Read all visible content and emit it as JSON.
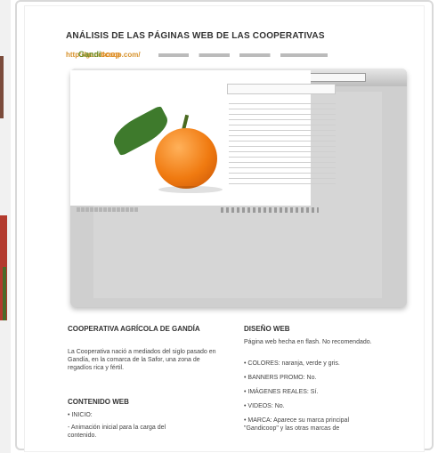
{
  "doc": {
    "title": "ANÁLISIS DE LAS PÁGINAS WEB DE LAS COOPERATIVAS",
    "url": "http://gandicoop.com/"
  },
  "screenshot": {
    "logo_prefix": "Gandi",
    "logo_suffix": "coop"
  },
  "left_column": {
    "heading": "COOPERATIVA AGRÍCOLA DE GANDÍA",
    "intro": "La Cooperativa nació a mediados del siglo pasado en Gandía, en la comarca de la Safor, una zona de regadíos rica y fértil.",
    "content_heading": "CONTENIDO WEB",
    "items": [
      "• INICIO:",
      "- Animación inicial para la carga del",
      "contenido."
    ]
  },
  "right_column": {
    "heading": "DISEÑO WEB",
    "intro": "Página web hecha en flash. No recomendado.",
    "items": [
      "• COLORES: naranja, verde y gris.",
      "• BANNERS PROMO: No.",
      "• IMÁGENES REALES: Sí.",
      "• VIDEOS: No.",
      "• MARCA: Aparece su marca principal",
      "\"Gandicoop\" y las otras marcas de"
    ]
  }
}
